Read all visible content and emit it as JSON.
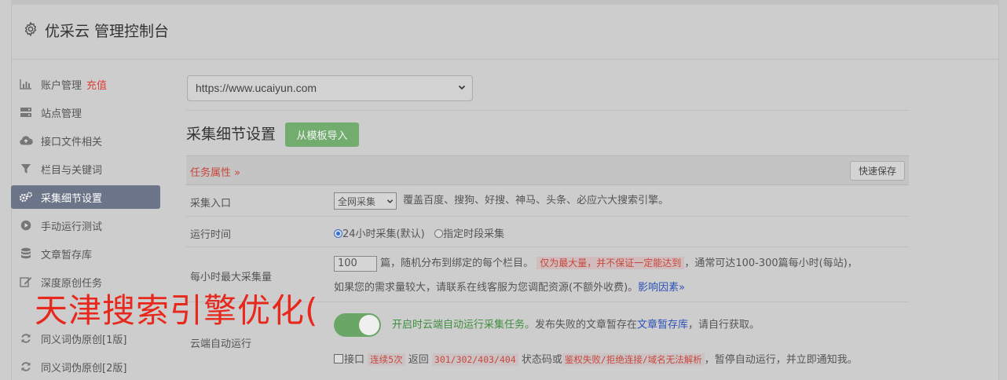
{
  "header": {
    "title": "优采云 管理控制台",
    "icon": "gear-icon"
  },
  "sidebar": {
    "items": [
      {
        "label": "账户管理",
        "extra": "充值",
        "icon": "bar-chart-icon"
      },
      {
        "label": "站点管理",
        "icon": "server-icon"
      },
      {
        "label": "接口文件相关",
        "icon": "cloud-upload-icon"
      },
      {
        "label": "栏目与关键词",
        "icon": "filter-icon"
      },
      {
        "label": "采集细节设置",
        "icon": "gears-icon",
        "active": true
      },
      {
        "label": "手动运行测试",
        "icon": "play-circle-icon"
      },
      {
        "label": "文章暂存库",
        "icon": "database-icon"
      },
      {
        "label": "深度原创任务",
        "icon": "edit-icon"
      },
      {
        "label": "同义词伪原创[1版]",
        "icon": "refresh-icon"
      },
      {
        "label": "同义词伪原创[2版]",
        "icon": "refresh-icon"
      }
    ]
  },
  "main": {
    "site_select": "https://www.ucaiyun.com",
    "section_title": "采集细节设置",
    "import_button": "从模板导入",
    "attr_label": "任务属性 »",
    "save_button": "快速保存",
    "rows": {
      "entry": {
        "label": "采集入口",
        "select": "全网采集",
        "desc": "覆盖百度、搜狗、好搜、神马、头条、必应六大搜索引擎。"
      },
      "runtime": {
        "label": "运行时间",
        "opt1": "24小时采集(默认)",
        "opt2": "指定时段采集"
      },
      "hourly": {
        "label": "每小时最大采集量",
        "value": "100",
        "text1": "篇，随机分布到绑定的每个栏目。",
        "warn": "仅为最大量，并不保证一定能达到",
        "text2": "，通常可达100-300篇每小时(每站)，",
        "text3": "如果您的需求量较大，请联系在线客服为您调配资源(不额外收费)。",
        "link": "影响因素»"
      },
      "cloud": {
        "label": "云端自动运行",
        "green": "开启时云端自动运行采集任务。",
        "text1": "发布失败的文章暂存在",
        "link": "文章暂存库",
        "text2": "，请自行获取。",
        "cb_label": "接口",
        "code1": "连续5次",
        "text3": "返回",
        "code2": "301/302/403/404",
        "text4": "状态码或",
        "code3": "鉴权失败/拒绝连接/域名无法解析",
        "text5": "，暂停自动运行，并立即通知我。"
      }
    }
  },
  "watermark": "天津搜索引擎优化(",
  "colors": {
    "active_nav": "#6b7488",
    "import_button": "#72ad6f",
    "warning": "#c9473d",
    "link": "#2c51b8"
  }
}
